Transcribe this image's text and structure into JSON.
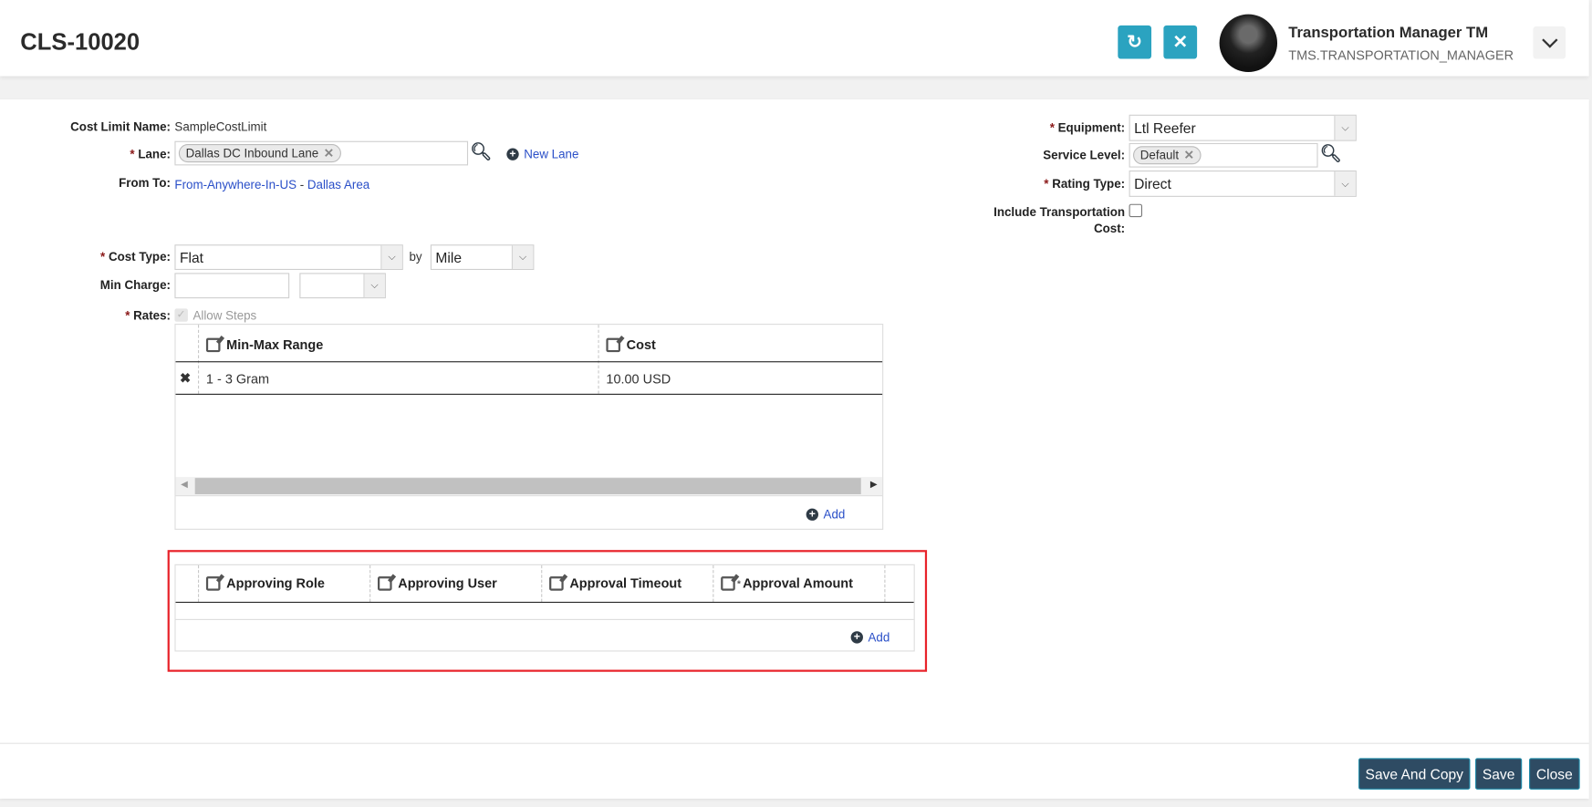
{
  "header": {
    "title": "CLS-10020",
    "refresh_icon": "refresh-icon",
    "close_icon": "close-icon",
    "user_name": "Transportation Manager TM",
    "user_role": "TMS.TRANSPORTATION_MANAGER"
  },
  "form": {
    "cost_limit_name_label": "Cost Limit Name:",
    "cost_limit_name": "SampleCostLimit",
    "lane_label": "Lane:",
    "lane_value": "Dallas DC Inbound Lane",
    "new_lane": "New Lane",
    "from_to_label": "From To:",
    "from": "From-Anywhere-In-US",
    "separator": " - ",
    "to": "Dallas Area",
    "cost_type_label": "Cost Type:",
    "cost_type": "Flat",
    "by_label": "by",
    "by_value": "Mile",
    "min_charge_label": "Min Charge:",
    "min_charge": "",
    "min_charge_unit": "",
    "rates_label": "Rates:",
    "allow_steps": "Allow Steps",
    "equipment_label": "Equipment:",
    "equipment": "Ltl Reefer",
    "service_level_label": "Service Level:",
    "service_level": "Default",
    "rating_type_label": "Rating Type:",
    "rating_type": "Direct",
    "include_transport_label_1": "Include Transportation",
    "include_transport_label_2": "Cost:",
    "required_mark": "*"
  },
  "rates_table": {
    "columns": [
      "Min-Max Range",
      "Cost"
    ],
    "rows": [
      {
        "range": "1 - 3 Gram",
        "cost": "10.00 USD"
      }
    ],
    "add": "Add"
  },
  "approval_table": {
    "columns": [
      "Approving Role",
      "Approving User",
      "Approval Timeout",
      "Approval Amount"
    ],
    "add": "Add"
  },
  "footer": {
    "save_and_copy": "Save And Copy",
    "save": "Save",
    "close": "Close"
  },
  "colors": {
    "accent": "#2ba3c0",
    "button": "#2e4b63",
    "highlight": "#e8232a",
    "link": "#2a4fc8"
  }
}
